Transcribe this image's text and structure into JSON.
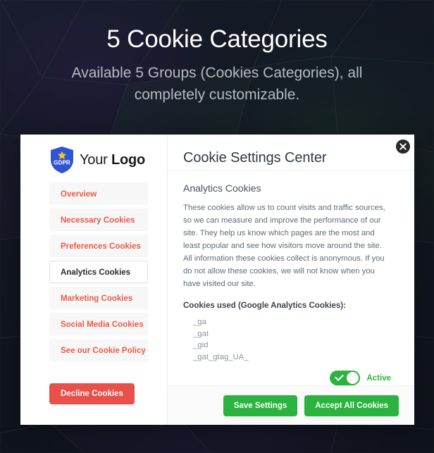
{
  "hero": {
    "title": "5 Cookie Categories",
    "subtitle": "Available 5 Groups (Cookies Categories), all completely customizable."
  },
  "modal": {
    "close_icon": "close-circle-icon",
    "brand": {
      "logo_icon": "gdpr-shield-icon",
      "shield_text": "GDPR",
      "name_light": "Your ",
      "name_bold": "Logo"
    },
    "sidebar": {
      "items": [
        {
          "label": "Overview",
          "active": false
        },
        {
          "label": "Necessary Cookies",
          "active": false
        },
        {
          "label": "Preferences Cookies",
          "active": false
        },
        {
          "label": "Analytics Cookies",
          "active": true
        },
        {
          "label": "Marketing Cookies",
          "active": false
        },
        {
          "label": "Social Media Cookies",
          "active": false
        },
        {
          "label": "See our Cookie Policy",
          "active": false
        }
      ],
      "decline_label": "Decline Cookies"
    },
    "content": {
      "title": "Cookie Settings Center",
      "section_title": "Analytics Cookies",
      "paragraph": "These cookies allow us to count visits and traffic sources, so we can measure and improve the performance of our site. They help us know which pages are the most and least popular and see how visitors move around the site. All information these cookies collect is anonymous. If you do not allow these cookies, we will not know when you have visited our site.",
      "cookies_used_label": "Cookies used (Google Analytics Cookies):",
      "cookies": [
        "_ga",
        "_gat",
        "_gid",
        "_gat_gtag_UA_"
      ],
      "toggle": {
        "state_label": "Active",
        "checked": true
      },
      "save_label": "Save Settings",
      "accept_label": "Accept All Cookies"
    }
  },
  "colors": {
    "accent_red": "#eb5a47",
    "decline_red": "#e8504a",
    "green": "#2bb33f",
    "shield_blue": "#2f55d4",
    "star_yellow": "#f5c518",
    "background_dark": "#141a26"
  }
}
